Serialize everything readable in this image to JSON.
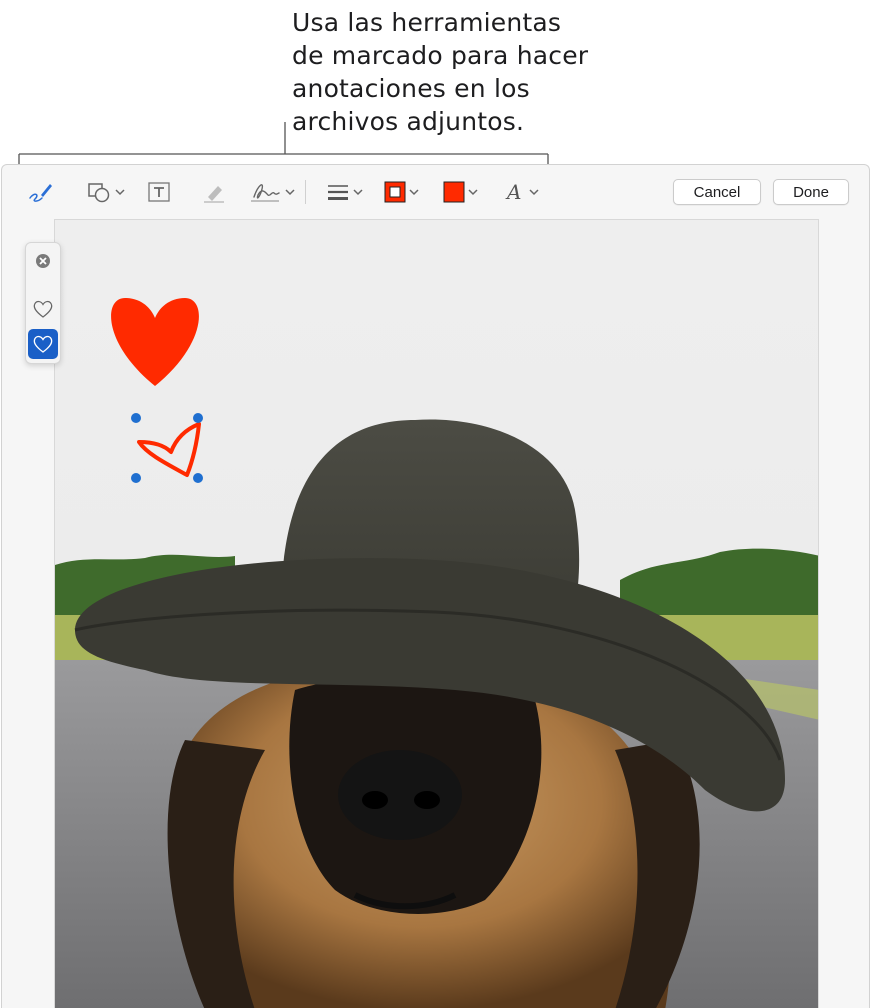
{
  "callout": {
    "lines": [
      "Usa las herramientas",
      "de marcado para hacer",
      "anotaciones en los",
      "archivos adjuntos."
    ]
  },
  "toolbar": {
    "tools": [
      "sketch-icon",
      "shapes-icon",
      "text-icon",
      "highlight-icon",
      "sign-icon",
      "line-style-icon",
      "border-color-icon",
      "fill-color-icon",
      "text-style-icon"
    ],
    "accent": "#2b6fd6",
    "border_color": "#ff2a00",
    "fill_color": "#ff2a00",
    "cancel_label": "Cancel",
    "done_label": "Done"
  },
  "shape_palette": {
    "items": [
      "close-icon",
      "heart-outline-icon",
      "heart-outline-icon"
    ],
    "selected_index": 2,
    "selected_color": "#1a5fc7"
  },
  "canvas": {
    "annotations": [
      "heart-shape",
      "sketched-heart-selected"
    ],
    "annotation_color": "#ff2a00",
    "handle_color": "#1f6fd0",
    "photo": "dog wearing hat"
  }
}
